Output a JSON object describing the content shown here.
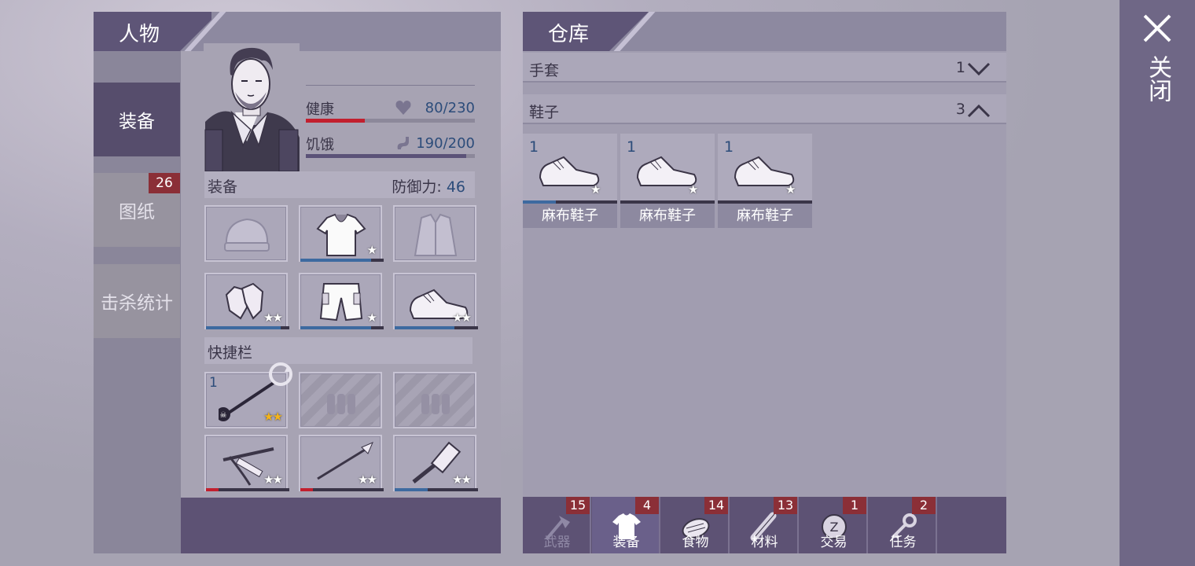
{
  "character_panel": {
    "title": "人物",
    "sidebar": [
      {
        "label": "装备",
        "active": true
      },
      {
        "label": "图纸",
        "badge": "26"
      },
      {
        "label": "击杀统计"
      }
    ],
    "stats": {
      "health": {
        "label": "健康",
        "value": "80/230",
        "fraction": 0.35
      },
      "hunger": {
        "label": "饥饿",
        "value": "190/200",
        "fraction": 0.95
      }
    },
    "equipment": {
      "title": "装备",
      "defense_label": "防御力:",
      "defense_value": "46",
      "slots": [
        {
          "icon": "beanie-icon",
          "stars": "",
          "durability": null
        },
        {
          "icon": "tshirt-icon",
          "stars": "★",
          "durability": 0.85
        },
        {
          "icon": "jacket-icon",
          "stars": "",
          "durability": null
        },
        {
          "icon": "gloves-icon",
          "stars": "★★",
          "durability": 0.9
        },
        {
          "icon": "shorts-icon",
          "stars": "★",
          "durability": 0.85
        },
        {
          "icon": "sneakers-icon",
          "stars": "★★",
          "durability": 0.72
        }
      ]
    },
    "quickbar": {
      "title": "快捷栏",
      "slots": [
        {
          "icon": "poison-spear-icon",
          "count": "1",
          "stars": "★★",
          "gold": true
        },
        {
          "icon": "ammo-empty-icon",
          "empty": true
        },
        {
          "icon": "ammo-empty-icon",
          "empty": true
        },
        {
          "icon": "crossbow-icon",
          "stars": "★★",
          "durability": 0.15,
          "durability_color": "#c21f2e"
        },
        {
          "icon": "spear-icon",
          "stars": "★★",
          "durability": 0.15,
          "durability_color": "#c21f2e"
        },
        {
          "icon": "sledgehammer-icon",
          "stars": "★★",
          "durability": 0.4
        }
      ]
    }
  },
  "warehouse": {
    "title": "仓库",
    "categories": [
      {
        "name": "手套",
        "count": "1",
        "chevron": "∨"
      },
      {
        "name": "鞋子",
        "count": "3",
        "chevron": "∧"
      }
    ],
    "items": [
      {
        "count": "1",
        "name": "麻布鞋子",
        "stars": "★",
        "durability": 0.35
      },
      {
        "count": "1",
        "name": "麻布鞋子",
        "stars": "★",
        "durability": 0.0
      },
      {
        "count": "1",
        "name": "麻布鞋子",
        "stars": "★",
        "durability": 0.0
      }
    ],
    "bottom_tabs": [
      {
        "label": "武器",
        "badge": "15",
        "icon": "axe-icon",
        "dim": true
      },
      {
        "label": "装备",
        "badge": "4",
        "icon": "shirt-icon",
        "active": true
      },
      {
        "label": "食物",
        "badge": "14",
        "icon": "food-icon"
      },
      {
        "label": "材料",
        "badge": "13",
        "icon": "wood-icon"
      },
      {
        "label": "交易",
        "badge": "1",
        "icon": "coin-icon"
      },
      {
        "label": "任务",
        "badge": "2",
        "icon": "key-icon"
      }
    ]
  },
  "close": {
    "label": "关闭"
  },
  "colors": {
    "accent": "#5e5577",
    "badge": "#8b2f37",
    "health": "#c21f2e",
    "hunger": "#5b5278",
    "durability": "#3d6aa0"
  }
}
